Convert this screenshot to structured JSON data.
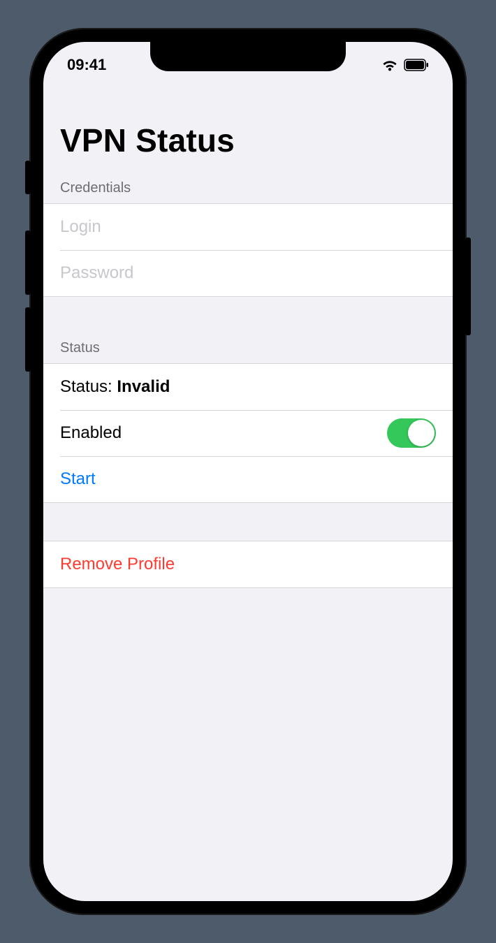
{
  "statusbar": {
    "time": "09:41"
  },
  "page": {
    "title": "VPN Status"
  },
  "credentials": {
    "header": "Credentials",
    "login_placeholder": "Login",
    "login_value": "",
    "password_placeholder": "Password",
    "password_value": ""
  },
  "status": {
    "header": "Status",
    "status_label_prefix": "Status: ",
    "status_value": "Invalid",
    "enabled_label": "Enabled",
    "enabled_value": true,
    "start_label": "Start"
  },
  "actions": {
    "remove_label": "Remove Profile"
  },
  "colors": {
    "accent": "#007aff",
    "destructive": "#ff3b30",
    "toggle_on": "#34c759",
    "background": "#f2f1f6"
  }
}
